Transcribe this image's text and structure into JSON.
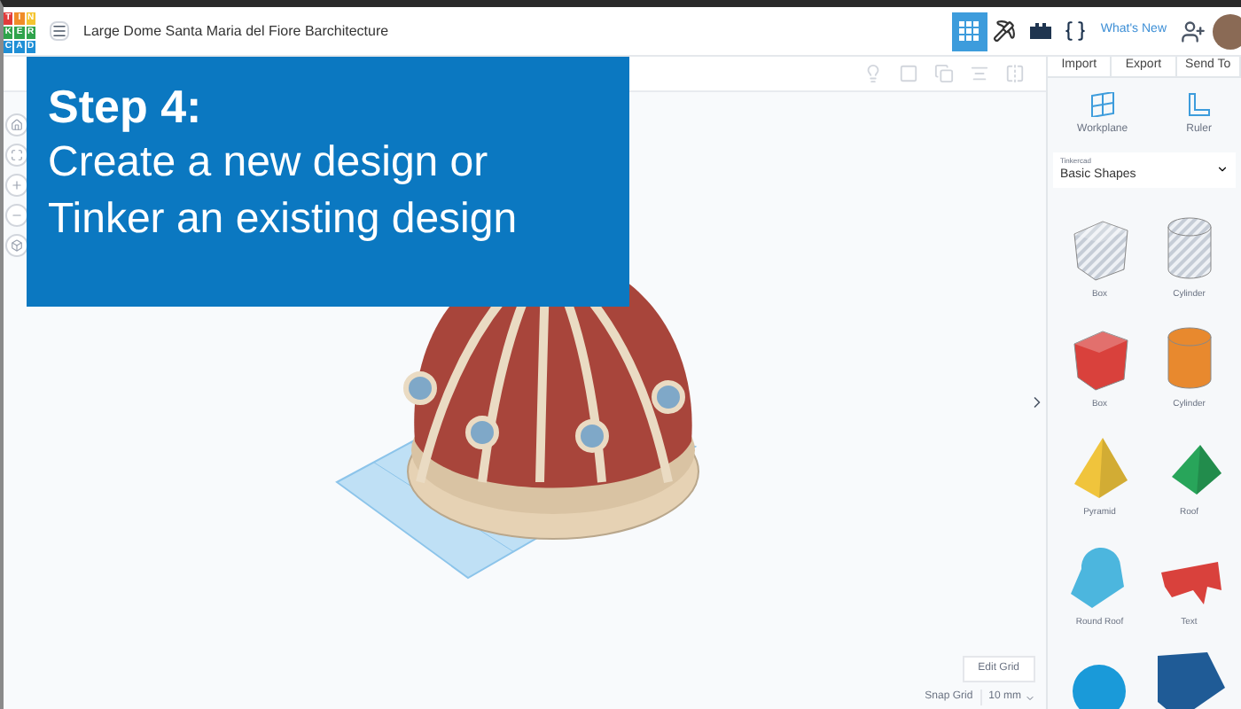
{
  "header": {
    "logo_letters": [
      "T",
      "I",
      "N",
      "K",
      "E",
      "R",
      "C",
      "A",
      "D"
    ],
    "title": "Large Dome Santa Maria del Fiore Barchitecture",
    "whats_new": "What's New",
    "views": [
      {
        "kind": "grid",
        "selected": true
      },
      {
        "kind": "build",
        "selected": false
      },
      {
        "kind": "bricks",
        "selected": false
      },
      {
        "kind": "code",
        "selected": false
      }
    ]
  },
  "toolbar": {
    "buttons": [
      "Import",
      "Export",
      "Send To"
    ]
  },
  "overlay": {
    "title": "Step 4:",
    "lines": [
      "Create a new design or",
      "Tinker an existing design"
    ]
  },
  "sidebar": {
    "tools": [
      {
        "kind": "workplane",
        "label": "Workplane"
      },
      {
        "kind": "ruler",
        "label": "Ruler"
      }
    ],
    "library": {
      "caption": "Tinkercad",
      "value": "Basic Shapes"
    },
    "shapes": [
      {
        "kind": "box",
        "label": "Box",
        "color": "#c5ccd6",
        "hole": true
      },
      {
        "kind": "cylinder",
        "label": "Cylinder",
        "color": "#c5ccd6",
        "hole": true
      },
      {
        "kind": "box",
        "label": "Box",
        "color": "#d9413c",
        "hole": false
      },
      {
        "kind": "cylinder",
        "label": "Cylinder",
        "color": "#e8892e",
        "hole": false
      },
      {
        "kind": "pyramid",
        "label": "Pyramid",
        "color": "#f0c43c",
        "hole": false
      },
      {
        "kind": "roof",
        "label": "Roof",
        "color": "#28a55a",
        "hole": false
      },
      {
        "kind": "roundroof",
        "label": "Round Roof",
        "color": "#4cb6de",
        "hole": false
      },
      {
        "kind": "text",
        "label": "Text",
        "color": "#d9413c",
        "hole": false
      },
      {
        "kind": "sphere",
        "color": "#1a9ad9",
        "hole": false
      },
      {
        "kind": "wedge",
        "color": "#1f5b96",
        "hole": false
      }
    ]
  },
  "grid": {
    "edit": "Edit Grid",
    "snap_label": "Snap Grid",
    "snap_value": "10 mm"
  }
}
